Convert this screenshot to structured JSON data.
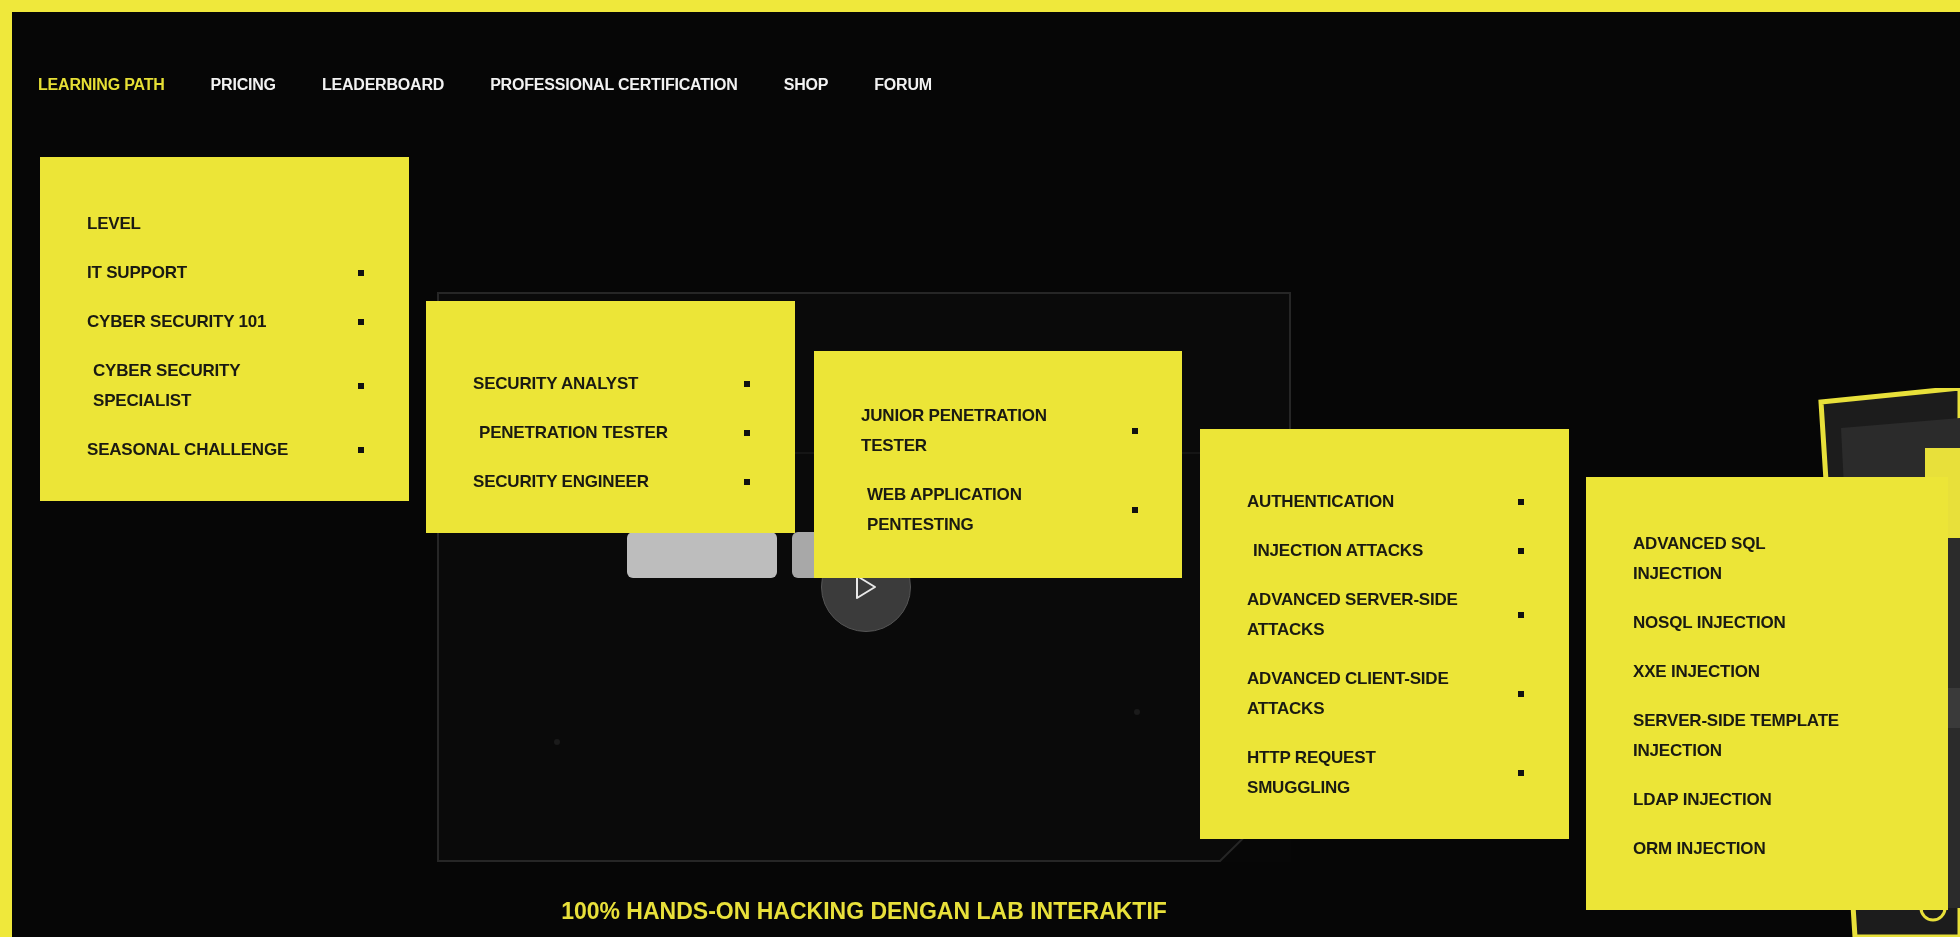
{
  "nav": [
    {
      "label": "LEARNING PATH",
      "selected": true
    },
    {
      "label": "PRICING",
      "selected": false
    },
    {
      "label": "LEADERBOARD",
      "selected": false
    },
    {
      "label": "PROFESSIONAL CERTIFICATION",
      "selected": false
    },
    {
      "label": "SHOP",
      "selected": false
    },
    {
      "label": "FORUM",
      "selected": false
    }
  ],
  "menus": [
    {
      "items": [
        {
          "kind": "heading",
          "label": "LEVEL"
        },
        {
          "kind": "link",
          "label": "IT SUPPORT",
          "has_submenu": true,
          "expanded": false
        },
        {
          "kind": "link",
          "label": "CYBER SECURITY 101",
          "has_submenu": true,
          "expanded": false
        },
        {
          "kind": "link",
          "label": "CYBER SECURITY SPECIALIST",
          "has_submenu": true,
          "expanded": true
        },
        {
          "kind": "link",
          "label": "SEASONAL CHALLENGE",
          "has_submenu": true,
          "expanded": false
        }
      ]
    },
    {
      "items": [
        {
          "kind": "link",
          "label": "SECURITY ANALYST",
          "has_submenu": true,
          "expanded": false
        },
        {
          "kind": "link",
          "label": "PENETRATION TESTER",
          "has_submenu": true,
          "expanded": true
        },
        {
          "kind": "link",
          "label": "SECURITY ENGINEER",
          "has_submenu": true,
          "expanded": false
        }
      ]
    },
    {
      "items": [
        {
          "kind": "link",
          "label": "JUNIOR PENETRATION TESTER",
          "has_submenu": true,
          "expanded": false
        },
        {
          "kind": "link",
          "label": "WEB APPLICATION PENTESTING",
          "has_submenu": true,
          "expanded": true
        }
      ]
    },
    {
      "items": [
        {
          "kind": "link",
          "label": "AUTHENTICATION",
          "has_submenu": true,
          "expanded": false
        },
        {
          "kind": "link",
          "label": "INJECTION ATTACKS",
          "has_submenu": true,
          "expanded": true
        },
        {
          "kind": "link",
          "label": "ADVANCED SERVER-SIDE ATTACKS",
          "has_submenu": true,
          "expanded": false
        },
        {
          "kind": "link",
          "label": "ADVANCED CLIENT-SIDE ATTACKS",
          "has_submenu": true,
          "expanded": false
        },
        {
          "kind": "link",
          "label": "HTTP REQUEST SMUGGLING",
          "has_submenu": true,
          "expanded": false
        }
      ]
    },
    {
      "items": [
        {
          "kind": "link",
          "label": "ADVANCED SQL INJECTION",
          "has_submenu": false,
          "expanded": false
        },
        {
          "kind": "link",
          "label": "NOSQL INJECTION",
          "has_submenu": false,
          "expanded": false
        },
        {
          "kind": "link",
          "label": "XXE INJECTION",
          "has_submenu": false,
          "expanded": false
        },
        {
          "kind": "link",
          "label": "SERVER-SIDE TEMPLATE INJECTION",
          "has_submenu": false,
          "expanded": false
        },
        {
          "kind": "link",
          "label": "LDAP INJECTION",
          "has_submenu": false,
          "expanded": false
        },
        {
          "kind": "link",
          "label": "ORM INJECTION",
          "has_submenu": false,
          "expanded": false
        }
      ]
    }
  ],
  "tagline": "100% HANDS-ON HACKING DENGAN LAB INTERAKTIF"
}
